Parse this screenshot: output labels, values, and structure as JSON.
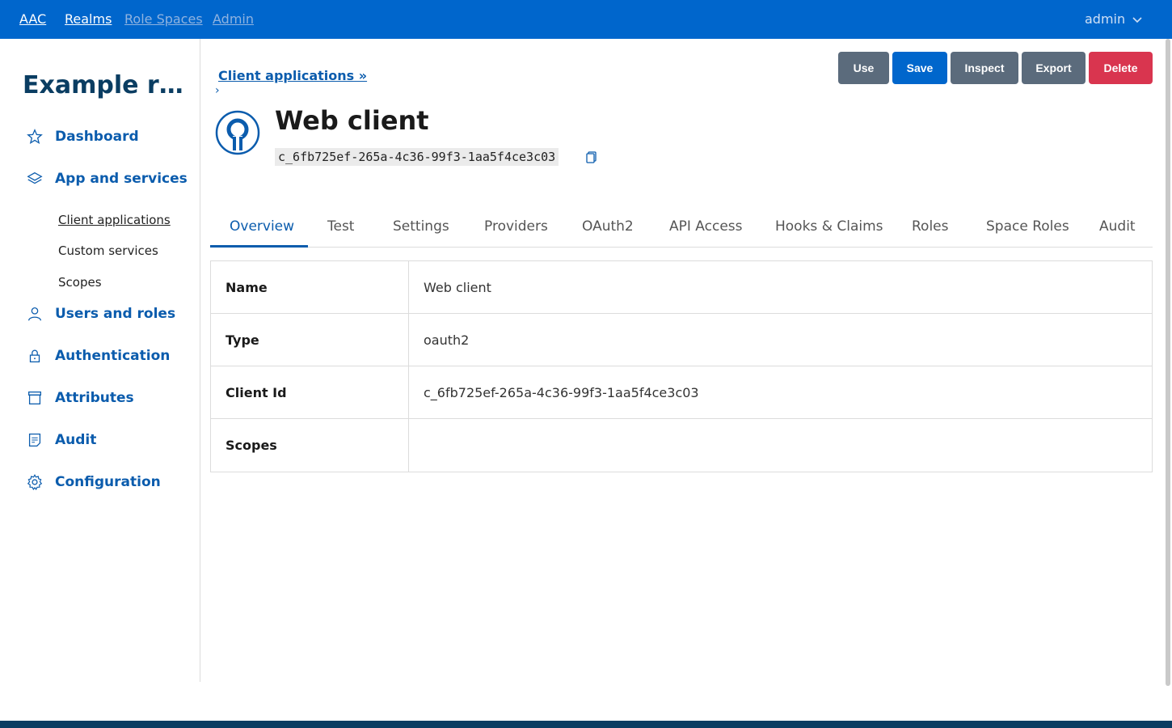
{
  "topbar": {
    "brand": "AAC",
    "nav": [
      "Realms",
      "Role Spaces",
      "Admin"
    ],
    "user": "admin"
  },
  "sidebar": {
    "realm_title": "Example real...",
    "items": [
      {
        "label": "Dashboard",
        "icon": "star-icon"
      },
      {
        "label": "App and services",
        "icon": "layers-icon"
      },
      {
        "label": "Users and roles",
        "icon": "user-icon"
      },
      {
        "label": "Authentication",
        "icon": "lock-icon"
      },
      {
        "label": "Attributes",
        "icon": "archive-icon"
      },
      {
        "label": "Audit",
        "icon": "document-icon"
      },
      {
        "label": "Configuration",
        "icon": "gear-icon"
      }
    ],
    "subitems": [
      "Client applications",
      "Custom services",
      "Scopes"
    ]
  },
  "header": {
    "breadcrumb": "Client applications »",
    "breadcrumb_chevron": "›",
    "title": "Web client",
    "client_id": "c_6fb725ef-265a-4c36-99f3-1aa5f4ce3c03"
  },
  "actions": {
    "use": "Use",
    "save": "Save",
    "inspect": "Inspect",
    "export": "Export",
    "delete": "Delete"
  },
  "tabs": [
    "Overview",
    "Test",
    "Settings",
    "Providers",
    "OAuth2",
    "API Access",
    "Hooks & Claims",
    "Roles",
    "Space Roles",
    "Audit"
  ],
  "details": [
    {
      "key": "Name",
      "value": "Web client"
    },
    {
      "key": "Type",
      "value": "oauth2"
    },
    {
      "key": "Client Id",
      "value": "c_6fb725ef-265a-4c36-99f3-1aa5f4ce3c03"
    },
    {
      "key": "Scopes",
      "value": ""
    }
  ],
  "colors": {
    "topbar": "#0066cc",
    "accent": "#0b5cad",
    "danger": "#d9354f",
    "secondary": "#5b6b7c"
  }
}
